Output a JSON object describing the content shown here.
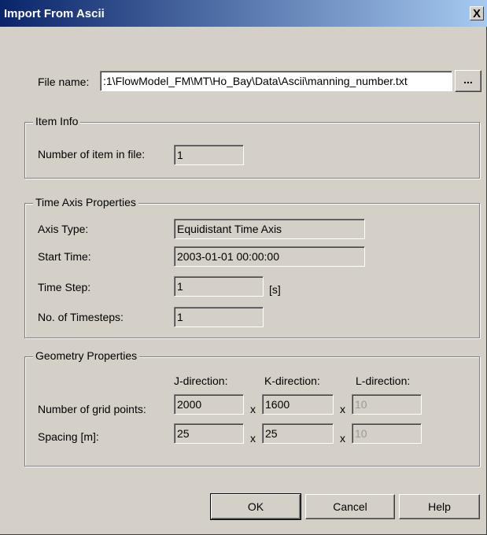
{
  "window": {
    "title": "Import From Ascii",
    "close_label": "X"
  },
  "file": {
    "label": "File name:",
    "value": ":1\\FlowModel_FM\\MT\\Ho_Bay\\Data\\Ascii\\manning_number.txt",
    "browse_label": "..."
  },
  "item_info": {
    "legend": "Item Info",
    "count_label": "Number of item in file:",
    "count_value": "1"
  },
  "time_axis": {
    "legend": "Time Axis Properties",
    "axis_type_label": "Axis Type:",
    "axis_type_value": "Equidistant Time Axis",
    "start_time_label": "Start Time:",
    "start_time_value": "2003-01-01  00:00:00",
    "time_step_label": "Time Step:",
    "time_step_value": "1",
    "time_step_unit": "[s]",
    "timesteps_label": "No. of Timesteps:",
    "timesteps_value": "1"
  },
  "geometry": {
    "legend": "Geometry Properties",
    "j_header": "J-direction:",
    "k_header": "K-direction:",
    "l_header": "L-direction:",
    "grid_label": "Number of grid points:",
    "grid_j": "2000",
    "grid_k": "1600",
    "grid_l": "10",
    "spacing_label": "Spacing [m]:",
    "spacing_j": "25",
    "spacing_k": "25",
    "spacing_l": "10",
    "times": "x"
  },
  "buttons": {
    "ok": "OK",
    "cancel": "Cancel",
    "help": "Help"
  }
}
